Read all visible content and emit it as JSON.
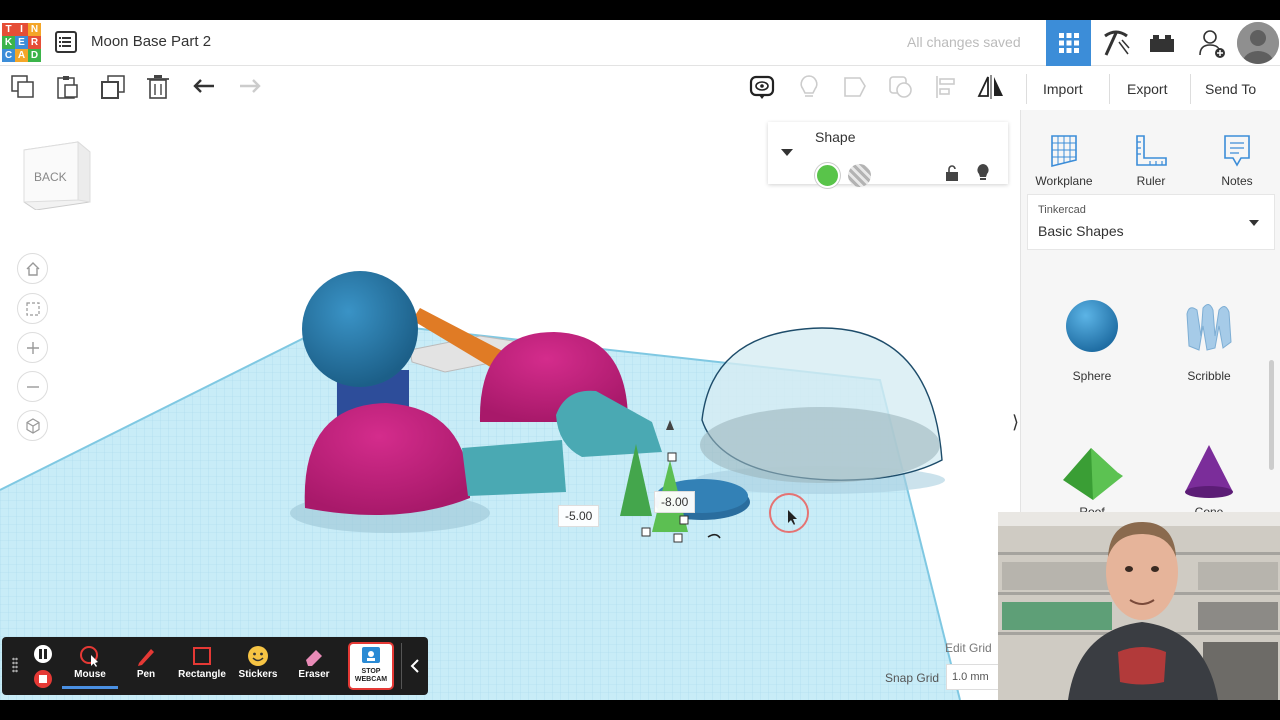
{
  "logo": {
    "letters": [
      "T",
      "I",
      "N",
      "K",
      "E",
      "R",
      "C",
      "A",
      "D"
    ],
    "colors": [
      "#e54e36",
      "#e54e36",
      "#f4a628",
      "#3bb44a",
      "#3c8dd8",
      "#e54e36",
      "#3c8dd8",
      "#f4a628",
      "#3bb44a"
    ]
  },
  "header": {
    "title": "Moon Base Part 2",
    "save_status": "All changes saved",
    "buttons": [
      "grid-view-icon",
      "pickaxe-icon",
      "bricks-icon",
      "add-user-icon"
    ],
    "accent": "#3c8dd8"
  },
  "toolbar": {
    "left_buttons": [
      "copy-icon",
      "paste-icon",
      "duplicate-icon",
      "delete-icon",
      "undo-icon",
      "redo-icon"
    ],
    "right_icons": [
      "notes-toggle-icon",
      "lightbulb-icon",
      "group-icon",
      "ungroup-icon",
      "align-icon",
      "mirror-icon"
    ],
    "import_label": "Import",
    "export_label": "Export",
    "send_to_label": "Send To"
  },
  "viewcube": {
    "face_label": "BACK"
  },
  "shape_panel": {
    "title": "Shape",
    "solid_color": "#59c44a",
    "hole_label": "hole"
  },
  "dimensions": {
    "left": "-5.00",
    "right": "-8.00"
  },
  "right_panel": {
    "tools": [
      {
        "label": "Workplane",
        "icon": "workplane-icon"
      },
      {
        "label": "Ruler",
        "icon": "ruler-icon"
      },
      {
        "label": "Notes",
        "icon": "notes-icon"
      }
    ],
    "library": {
      "provider": "Tinkercad",
      "category": "Basic Shapes"
    },
    "shapes": [
      {
        "label": "Sphere",
        "color": "#3b93cf"
      },
      {
        "label": "Scribble",
        "color": "#9ec7e6"
      },
      {
        "label": "Roof",
        "color": "#45b13e"
      },
      {
        "label": "Cone",
        "color": "#7b2d9a"
      }
    ]
  },
  "grid": {
    "edit_label": "Edit Grid",
    "snap_label": "Snap Grid",
    "snap_value": "1.0 mm"
  },
  "recorder": {
    "tools": [
      {
        "label": "Mouse"
      },
      {
        "label": "Pen"
      },
      {
        "label": "Rectangle"
      },
      {
        "label": "Stickers"
      },
      {
        "label": "Eraser"
      }
    ],
    "stop_label": "STOP WEBCAM"
  }
}
